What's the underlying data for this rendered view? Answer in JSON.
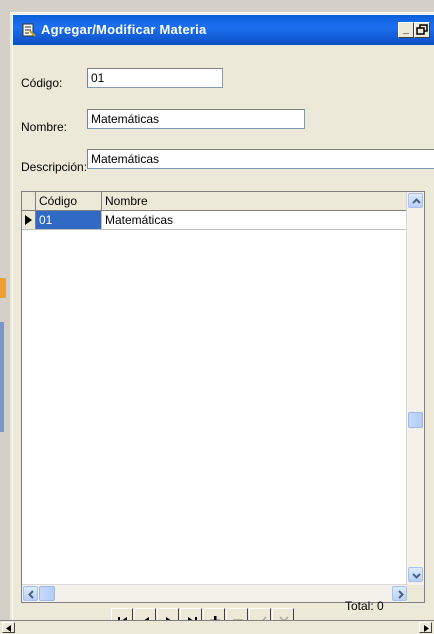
{
  "window": {
    "title": "Agregar/Modificar Materia",
    "minimize_label": "_",
    "restore_label": "🗗"
  },
  "form": {
    "codigo_label": "Código:",
    "codigo_value": "01",
    "nombre_label": "Nombre:",
    "nombre_value": "Matemáticas",
    "descripcion_label": "Descripción:",
    "descripcion_value": "Matemáticas"
  },
  "grid": {
    "columns": [
      "Código",
      "Nombre"
    ],
    "rows": [
      {
        "codigo": "01",
        "nombre": "Matemáticas"
      }
    ]
  },
  "navigator": {
    "buttons": [
      "first-icon",
      "prior-icon",
      "next-icon",
      "last-icon",
      "insert-icon",
      "delete-icon",
      "post-icon",
      "cancel-icon"
    ],
    "total_label": "Total: 0"
  },
  "colors": {
    "titlebar": "#0a5fd8",
    "selection": "#316ac5",
    "face": "#ece9d8"
  }
}
